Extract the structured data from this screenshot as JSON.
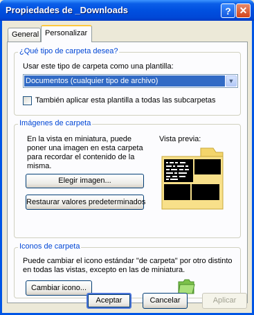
{
  "window": {
    "title": "Propiedades de _Downloads",
    "help_glyph": "?",
    "close_glyph": "✕"
  },
  "tabs": [
    {
      "label": "General",
      "active": false
    },
    {
      "label": "Personalizar",
      "active": true
    }
  ],
  "folder_type": {
    "group_title": "¿Qué tipo de carpeta desea?",
    "template_label": "Usar este tipo de carpeta como una plantilla:",
    "selected_template": "Documentos (cualquier tipo de archivo)",
    "apply_subfolders_label": "También aplicar esta plantilla a todas las subcarpetas",
    "apply_subfolders_checked": false
  },
  "folder_images": {
    "group_title": "Imágenes de carpeta",
    "description_lines": [
      "En la vista en miniatura, puede",
      "poner una imagen en esta carpeta",
      "para recordar el contenido de la",
      "misma."
    ],
    "choose_image_button": "Elegir imagen...",
    "restore_defaults_button": "Restaurar valores predeterminados",
    "preview_label": "Vista previa:"
  },
  "folder_icons": {
    "group_title": "Iconos de carpeta",
    "description_lines": [
      "Puede cambiar el icono estándar \"de carpeta\" por otro distinto",
      "en todas las vistas, excepto en las de miniatura."
    ],
    "change_icon_button": "Cambiar icono..."
  },
  "dialog_buttons": {
    "ok": "Aceptar",
    "cancel": "Cancelar",
    "apply": "Aplicar"
  },
  "colors": {
    "titlebar": "#0054e3",
    "group_title": "#0046d5",
    "selection": "#316ac5",
    "folder_yellow": "#f3d56b",
    "folder_green": "#8fd15a"
  }
}
